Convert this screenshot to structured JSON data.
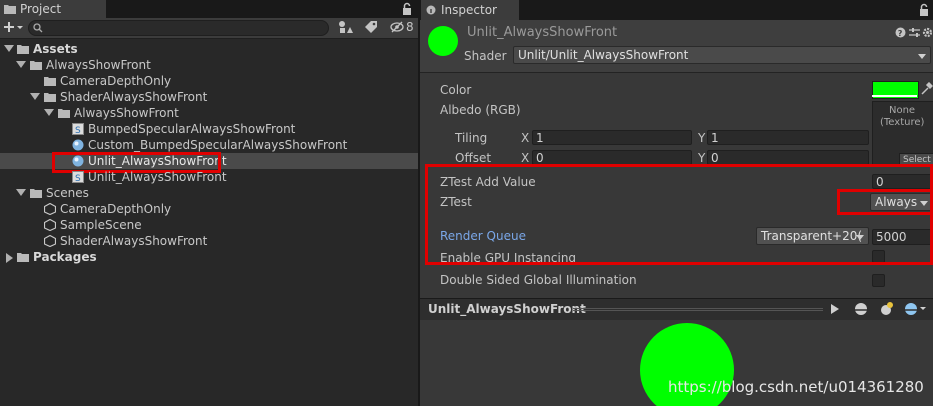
{
  "project": {
    "tab_label": "Project",
    "search_placeholder": "",
    "hidden_count": "8",
    "tree": [
      {
        "label": "Assets",
        "bold": true
      },
      {
        "label": "AlwaysShowFront"
      },
      {
        "label": "CameraDepthOnly"
      },
      {
        "label": "ShaderAlwaysShowFront"
      },
      {
        "label": "AlwaysShowFront"
      },
      {
        "label": "BumpedSpecularAlwaysShowFront"
      },
      {
        "label": "Custom_BumpedSpecularAlwaysShowFront"
      },
      {
        "label": "Unlit_AlwaysShowFront",
        "selected": true
      },
      {
        "label": "Unlit_AlwaysShowFront"
      },
      {
        "label": "Scenes"
      },
      {
        "label": "CameraDepthOnly"
      },
      {
        "label": "SampleScene"
      },
      {
        "label": "ShaderAlwaysShowFront"
      },
      {
        "label": "Packages",
        "bold": true
      }
    ]
  },
  "inspector": {
    "tab_label": "Inspector",
    "material_name": "Unlit_AlwaysShowFront",
    "shader_label": "Shader",
    "shader_value": "Unlit/Unlit_AlwaysShowFront",
    "color_label": "Color",
    "color_value": "#00ff00",
    "albedo_label": "Albedo (RGB)",
    "texture_none": "None",
    "texture_type": "(Texture)",
    "select_label": "Select",
    "tiling_label": "Tiling",
    "offset_label": "Offset",
    "x_label": "X",
    "y_label": "Y",
    "tiling_x": "1",
    "tiling_y": "1",
    "offset_x": "0",
    "offset_y": "0",
    "ztest_add_label": "ZTest Add Value",
    "ztest_add_value": "0",
    "ztest_label": "ZTest",
    "ztest_value": "Always",
    "render_queue_label": "Render Queue",
    "render_queue_mode": "Transparent+20(",
    "render_queue_value": "5000",
    "gpu_instancing_label": "Enable GPU Instancing",
    "double_sided_label": "Double Sided Global Illumination",
    "preview_title": "Unlit_AlwaysShowFront",
    "watermark": "https://blog.csdn.net/u014361280"
  },
  "colors": {
    "accent_green": "#00ff00",
    "highlight_red": "#e00000",
    "link_blue": "#7aa7e8"
  }
}
